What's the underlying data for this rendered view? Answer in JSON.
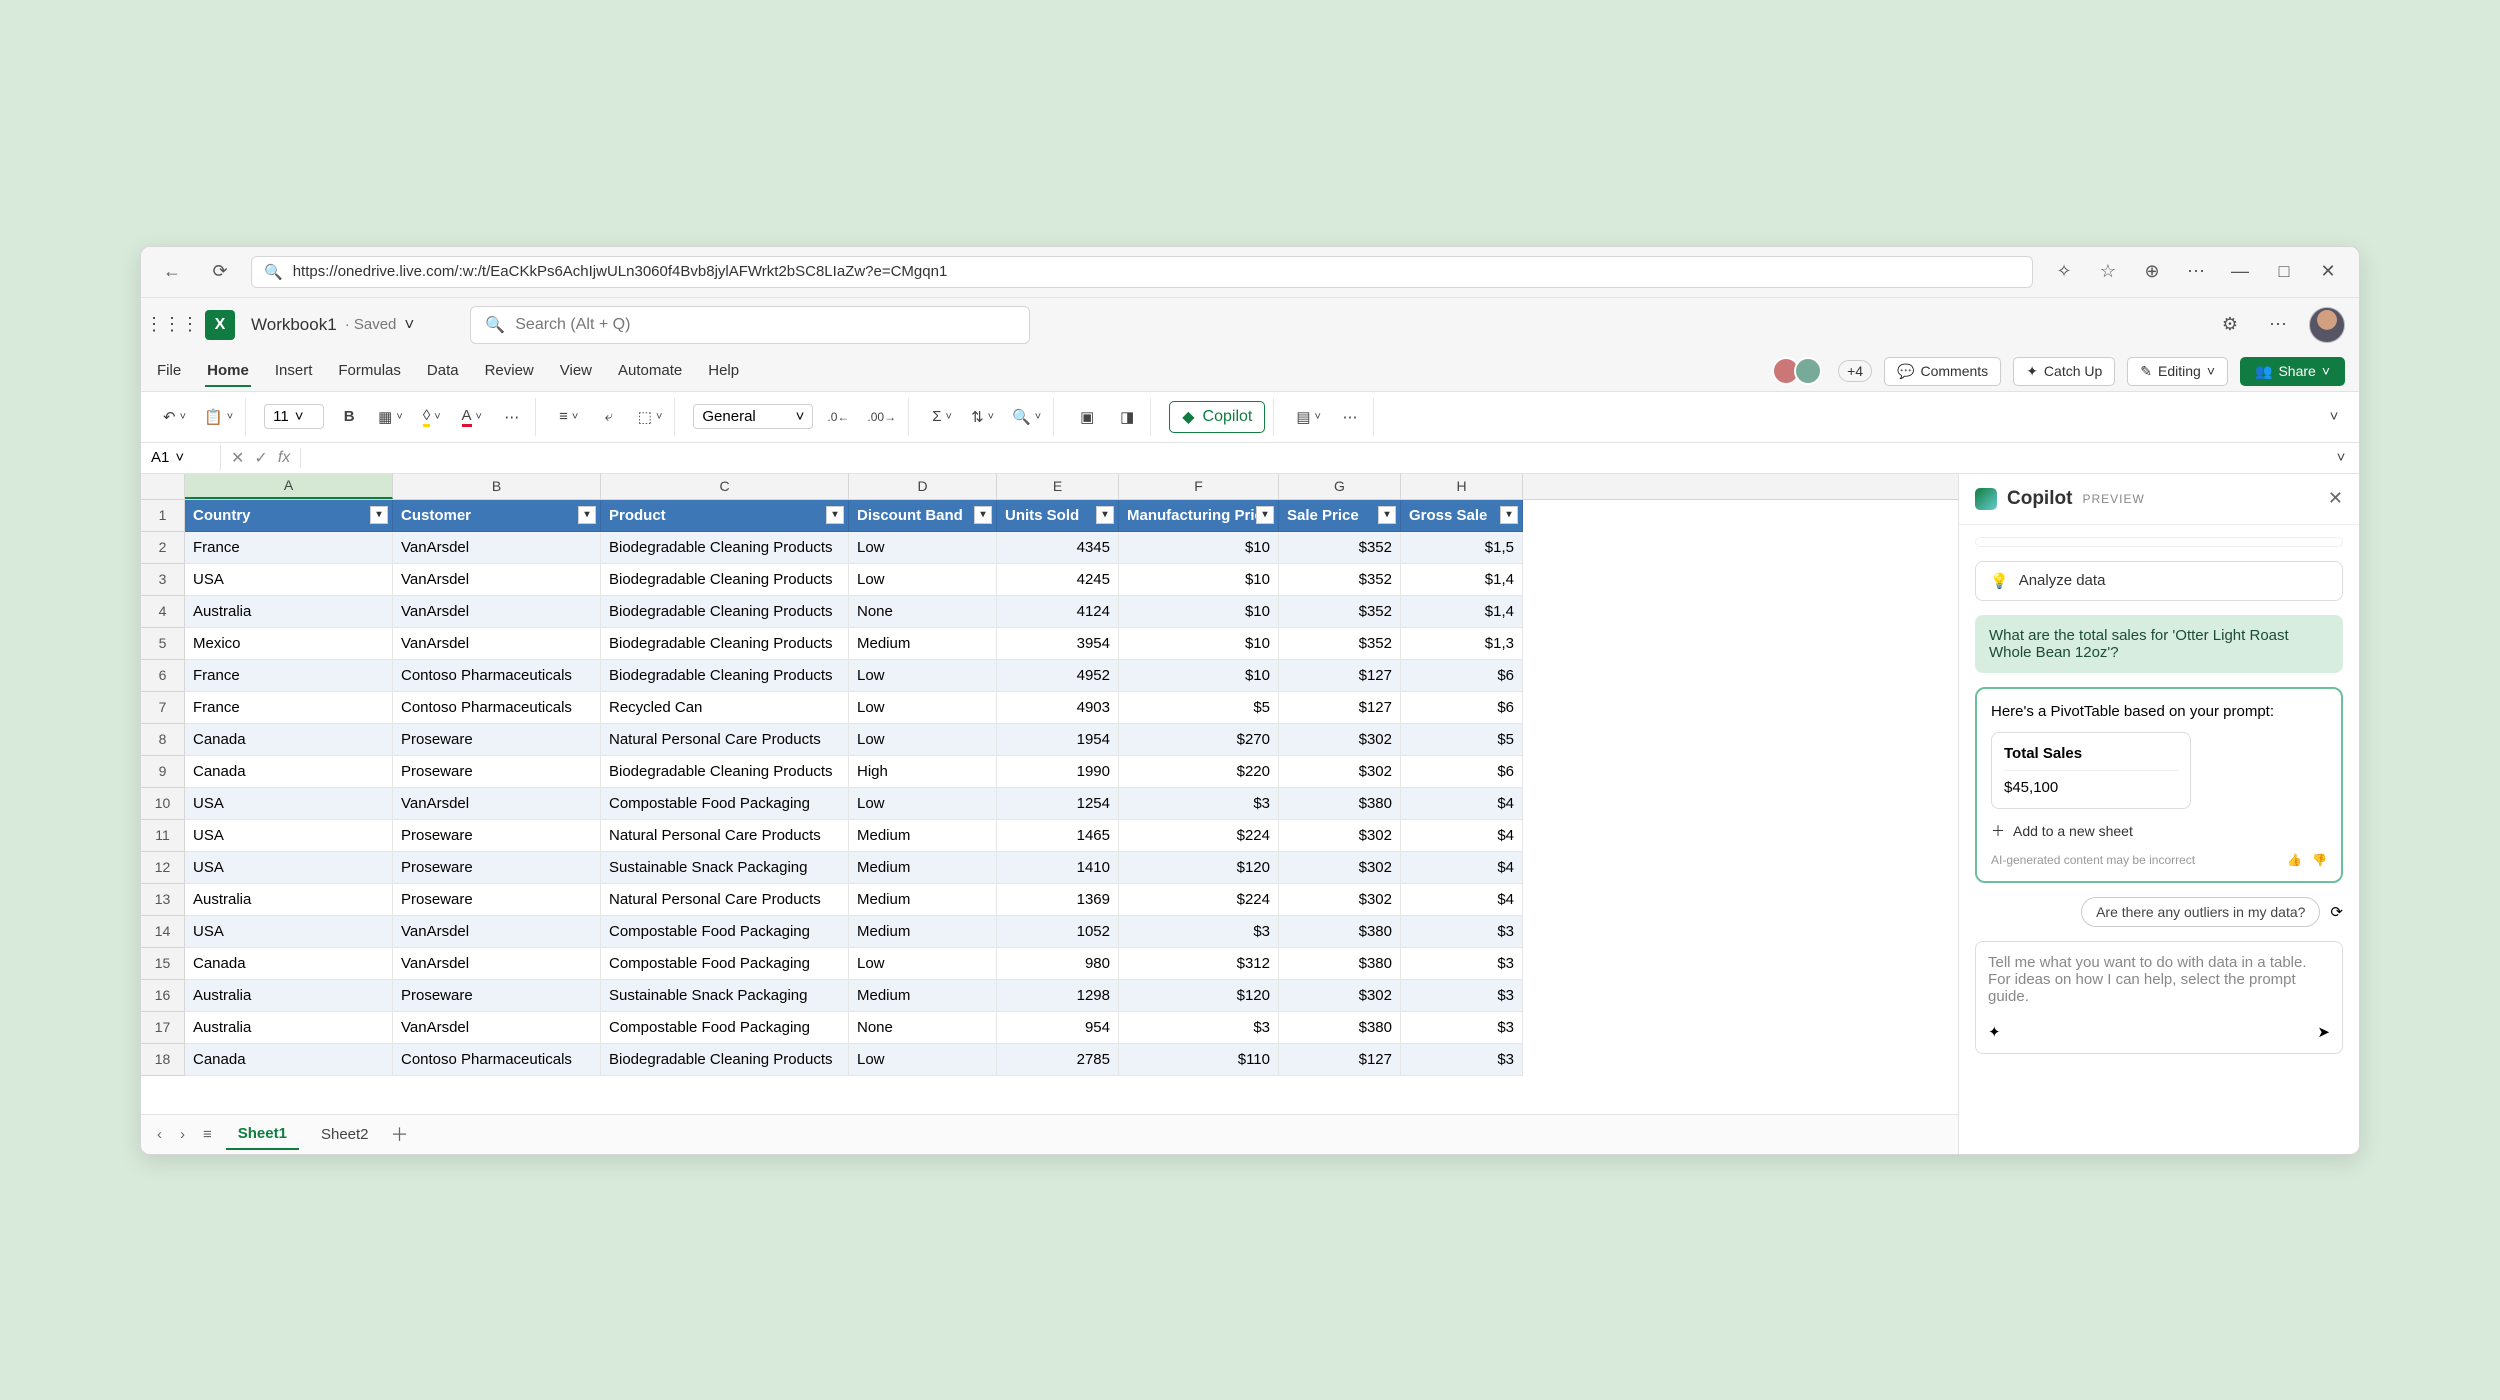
{
  "browser": {
    "url": "https://onedrive.live.com/:w:/t/EaCKkPs6AchIjwULn3060f4Bvb8jylAFWrkt2bSC8LIaZw?e=CMgqn1"
  },
  "title": {
    "workbook": "Workbook1",
    "status": "· Saved",
    "search_placeholder": "Search (Alt + Q)"
  },
  "ribbon": {
    "tabs": [
      "File",
      "Home",
      "Insert",
      "Formulas",
      "Data",
      "Review",
      "View",
      "Automate",
      "Help"
    ],
    "active_index": 1,
    "presence_extra": "+4",
    "comments": "Comments",
    "catch_up": "Catch Up",
    "editing": "Editing",
    "share": "Share"
  },
  "toolbar": {
    "font_size": "11",
    "number_format": "General",
    "copilot": "Copilot"
  },
  "namebox": {
    "ref": "A1"
  },
  "columns": {
    "letters": [
      "A",
      "B",
      "C",
      "D",
      "E",
      "F",
      "G",
      "H"
    ],
    "headers": [
      "Country",
      "Customer",
      "Product",
      "Discount Band",
      "Units Sold",
      "Manufacturing Price",
      "Sale Price",
      "Gross Sale"
    ]
  },
  "rows": [
    {
      "n": 2,
      "c": [
        "France",
        "VanArsdel",
        "Biodegradable Cleaning Products",
        "Low",
        "4345",
        "$10",
        "$352",
        "$1,5"
      ]
    },
    {
      "n": 3,
      "c": [
        "USA",
        "VanArsdel",
        "Biodegradable Cleaning Products",
        "Low",
        "4245",
        "$10",
        "$352",
        "$1,4"
      ]
    },
    {
      "n": 4,
      "c": [
        "Australia",
        "VanArsdel",
        "Biodegradable Cleaning Products",
        "None",
        "4124",
        "$10",
        "$352",
        "$1,4"
      ]
    },
    {
      "n": 5,
      "c": [
        "Mexico",
        "VanArsdel",
        "Biodegradable Cleaning Products",
        "Medium",
        "3954",
        "$10",
        "$352",
        "$1,3"
      ]
    },
    {
      "n": 6,
      "c": [
        "France",
        "Contoso Pharmaceuticals",
        "Biodegradable Cleaning Products",
        "Low",
        "4952",
        "$10",
        "$127",
        "$6"
      ]
    },
    {
      "n": 7,
      "c": [
        "France",
        "Contoso Pharmaceuticals",
        "Recycled Can",
        "Low",
        "4903",
        "$5",
        "$127",
        "$6"
      ]
    },
    {
      "n": 8,
      "c": [
        "Canada",
        "Proseware",
        "Natural Personal Care Products",
        "Low",
        "1954",
        "$270",
        "$302",
        "$5"
      ]
    },
    {
      "n": 9,
      "c": [
        "Canada",
        "Proseware",
        "Biodegradable Cleaning Products",
        "High",
        "1990",
        "$220",
        "$302",
        "$6"
      ]
    },
    {
      "n": 10,
      "c": [
        "USA",
        "VanArsdel",
        "Compostable Food Packaging",
        "Low",
        "1254",
        "$3",
        "$380",
        "$4"
      ]
    },
    {
      "n": 11,
      "c": [
        "USA",
        "Proseware",
        "Natural Personal Care Products",
        "Medium",
        "1465",
        "$224",
        "$302",
        "$4"
      ]
    },
    {
      "n": 12,
      "c": [
        "USA",
        "Proseware",
        "Sustainable Snack Packaging",
        "Medium",
        "1410",
        "$120",
        "$302",
        "$4"
      ]
    },
    {
      "n": 13,
      "c": [
        "Australia",
        "Proseware",
        "Natural Personal Care Products",
        "Medium",
        "1369",
        "$224",
        "$302",
        "$4"
      ]
    },
    {
      "n": 14,
      "c": [
        "USA",
        "VanArsdel",
        "Compostable Food Packaging",
        "Medium",
        "1052",
        "$3",
        "$380",
        "$3"
      ]
    },
    {
      "n": 15,
      "c": [
        "Canada",
        "VanArsdel",
        "Compostable Food Packaging",
        "Low",
        "980",
        "$312",
        "$380",
        "$3"
      ]
    },
    {
      "n": 16,
      "c": [
        "Australia",
        "Proseware",
        "Sustainable Snack Packaging",
        "Medium",
        "1298",
        "$120",
        "$302",
        "$3"
      ]
    },
    {
      "n": 17,
      "c": [
        "Australia",
        "VanArsdel",
        "Compostable Food Packaging",
        "None",
        "954",
        "$3",
        "$380",
        "$3"
      ]
    },
    {
      "n": 18,
      "c": [
        "Canada",
        "Contoso Pharmaceuticals",
        "Biodegradable Cleaning Products",
        "Low",
        "2785",
        "$110",
        "$127",
        "$3"
      ]
    }
  ],
  "sheets": {
    "tabs": [
      "Sheet1",
      "Sheet2"
    ],
    "active_index": 0
  },
  "copilot": {
    "title": "Copilot",
    "preview": "PREVIEW",
    "suggestion": "Analyze data",
    "user_prompt": "What are the total sales for 'Otter Light Roast Whole Bean 12oz'?",
    "bot_intro": "Here's a PivotTable based on your prompt:",
    "pivot_title": "Total Sales",
    "pivot_value": "$45,100",
    "add_sheet": "Add to a new sheet",
    "disclaimer": "AI-generated content may be incorrect",
    "followup": "Are there any outliers in my data?",
    "prompt_placeholder": "Tell me what you want to do with data in a table. For ideas on how I can help, select the prompt guide."
  }
}
